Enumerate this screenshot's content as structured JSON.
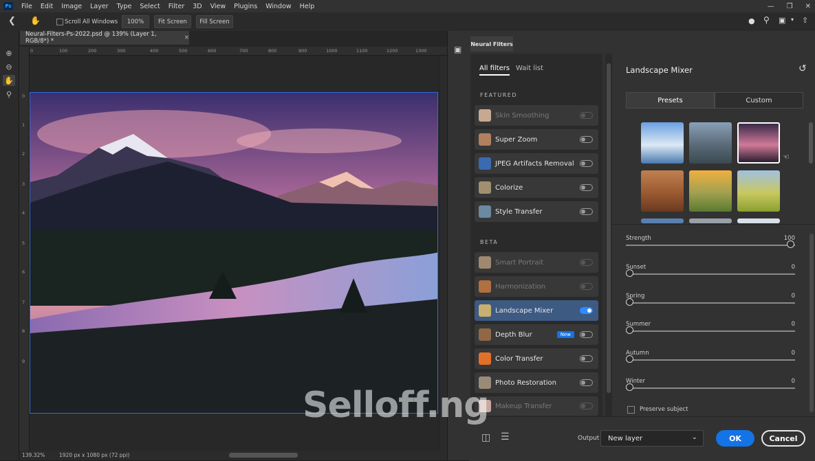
{
  "menubar": {
    "logo": "Ps",
    "items": [
      "File",
      "Edit",
      "Image",
      "Layer",
      "Type",
      "Select",
      "Filter",
      "3D",
      "View",
      "Plugins",
      "Window",
      "Help"
    ]
  },
  "options": {
    "scroll_all_label": "Scroll All Windows",
    "zoom_value": "100%",
    "fit_screen": "Fit Screen",
    "fill_screen": "Fill Screen"
  },
  "document": {
    "tab_title": "Neural-Filters-Ps-2022.psd @ 139% (Layer 1, RGB/8*) *",
    "close": "×",
    "h_ruler": [
      "0",
      "100",
      "200",
      "300",
      "400",
      "500",
      "600",
      "700",
      "800",
      "900",
      "1000",
      "1100",
      "1200",
      "1300"
    ],
    "v_ruler": [
      "0",
      "1",
      "2",
      "3",
      "4",
      "5",
      "6",
      "7",
      "8",
      "9"
    ],
    "zoom": "139.32%",
    "info": "1920 px x 1080 px (72 ppi)"
  },
  "neural_filters": {
    "panel_tab": "Neural Filters",
    "tabs": [
      "All filters",
      "Wait list"
    ],
    "featured_heading": "FEATURED",
    "beta_heading": "BETA",
    "featured": [
      {
        "label": "Skin Smoothing",
        "enabled": false,
        "dim": true
      },
      {
        "label": "Super Zoom",
        "enabled": false,
        "dim": false
      },
      {
        "label": "JPEG Artifacts Removal",
        "enabled": false,
        "dim": false
      },
      {
        "label": "Colorize",
        "enabled": false,
        "dim": false
      },
      {
        "label": "Style Transfer",
        "enabled": false,
        "dim": false
      }
    ],
    "beta": [
      {
        "label": "Smart Portrait",
        "enabled": false,
        "dim": true
      },
      {
        "label": "Harmonization",
        "enabled": false,
        "dim": true
      },
      {
        "label": "Landscape Mixer",
        "enabled": true,
        "dim": false,
        "selected": true
      },
      {
        "label": "Depth Blur",
        "enabled": false,
        "dim": false,
        "badge": "New"
      },
      {
        "label": "Color Transfer",
        "enabled": false,
        "dim": false
      },
      {
        "label": "Photo Restoration",
        "enabled": false,
        "dim": false
      },
      {
        "label": "Makeup Transfer",
        "enabled": false,
        "dim": true
      }
    ]
  },
  "detail": {
    "title": "Landscape Mixer",
    "presets_tab": "Presets",
    "custom_tab": "Custom",
    "sliders": [
      {
        "name": "Strength",
        "value": "100",
        "pct": 1.0
      },
      {
        "name": "Sunset",
        "value": "0",
        "pct": 0
      },
      {
        "name": "Spring",
        "value": "0",
        "pct": 0
      },
      {
        "name": "Summer",
        "value": "0",
        "pct": 0
      },
      {
        "name": "Autumn",
        "value": "0",
        "pct": 0
      },
      {
        "name": "Winter",
        "value": "0",
        "pct": 0
      }
    ],
    "preserve_subject": "Preserve subject"
  },
  "footer": {
    "output_label": "Output",
    "output_value": "New layer",
    "ok": "OK",
    "cancel": "Cancel"
  },
  "watermark": "Selloff.ng"
}
